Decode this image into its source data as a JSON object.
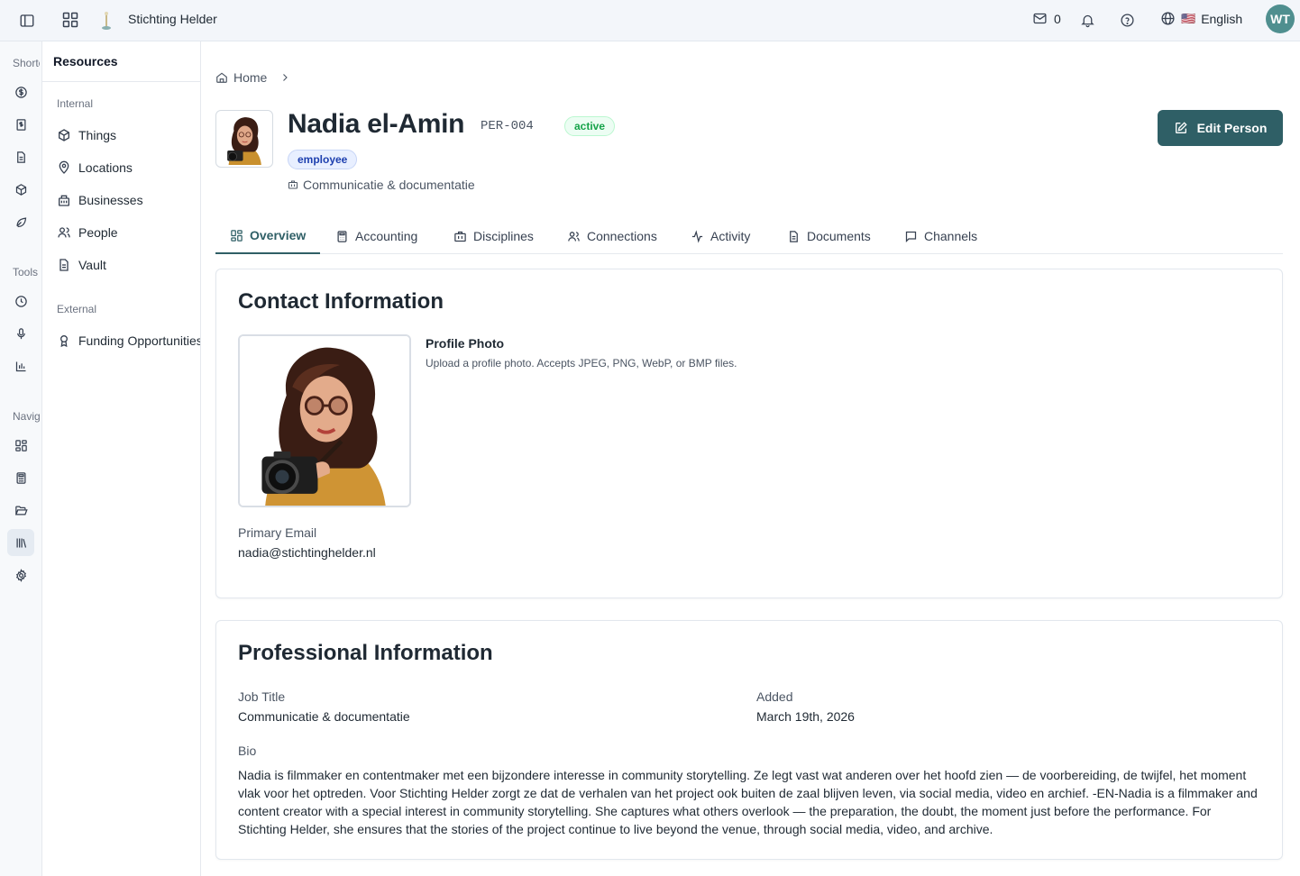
{
  "app": {
    "org_name": "Stichting Helder",
    "mail_count": "0",
    "language": "English",
    "language_flag": "🇺🇸",
    "user_initials": "WT"
  },
  "rail": {
    "label_shortcuts": "Shortcuts",
    "label_tools": "Tools",
    "label_navigation": "Navigation"
  },
  "subnav": {
    "title": "Resources",
    "internal_label": "Internal",
    "external_label": "External",
    "items": [
      {
        "label": "Things",
        "icon": "box-icon"
      },
      {
        "label": "Locations",
        "icon": "map-pin-icon"
      },
      {
        "label": "Businesses",
        "icon": "building-icon"
      },
      {
        "label": "People",
        "icon": "users-icon"
      },
      {
        "label": "Vault",
        "icon": "file-icon"
      }
    ],
    "external_items": [
      {
        "label": "Funding Opportunities",
        "icon": "award-icon"
      }
    ]
  },
  "breadcrumb": {
    "home": "Home"
  },
  "person": {
    "name": "Nadia el-Amin",
    "code": "PER-004",
    "status": "active",
    "role": "employee",
    "department": "Communicatie & documentatie",
    "edit_label": "Edit Person"
  },
  "tabs": [
    {
      "label": "Overview",
      "icon": "layout-grid-icon",
      "active": true
    },
    {
      "label": "Accounting",
      "icon": "calculator-icon"
    },
    {
      "label": "Disciplines",
      "icon": "briefcase-icon"
    },
    {
      "label": "Connections",
      "icon": "users-icon"
    },
    {
      "label": "Activity",
      "icon": "activity-icon"
    },
    {
      "label": "Documents",
      "icon": "document-icon"
    },
    {
      "label": "Channels",
      "icon": "message-icon"
    }
  ],
  "contact": {
    "title": "Contact Information",
    "photo_title": "Profile Photo",
    "photo_desc": "Upload a profile photo. Accepts JPEG, PNG, WebP, or BMP files.",
    "email_label": "Primary Email",
    "email": "nadia@stichtinghelder.nl"
  },
  "professional": {
    "title": "Professional Information",
    "job_title_label": "Job Title",
    "job_title": "Communicatie & documentatie",
    "added_label": "Added",
    "added": "March 19th, 2026",
    "bio_label": "Bio",
    "bio": "Nadia is filmmaker en contentmaker met een bijzondere interesse in community storytelling. Ze legt vast wat anderen over het hoofd zien — de voorbereiding, de twijfel, het moment vlak voor het optreden. Voor Stichting Helder zorgt ze dat de verhalen van het project ook buiten de zaal blijven leven, via social media, video en archief. -EN-Nadia is a filmmaker and content creator with a special interest in community storytelling. She captures what others overlook — the preparation, the doubt, the moment just before the performance. For Stichting Helder, she ensures that the stories of the project continue to live beyond the venue, through social media, video, and archive."
  },
  "colors": {
    "primary": "#2f5f66",
    "active_green": "#16a34a",
    "role_blue": "#1e40af",
    "avatar_bg": "#4f8f8f"
  }
}
